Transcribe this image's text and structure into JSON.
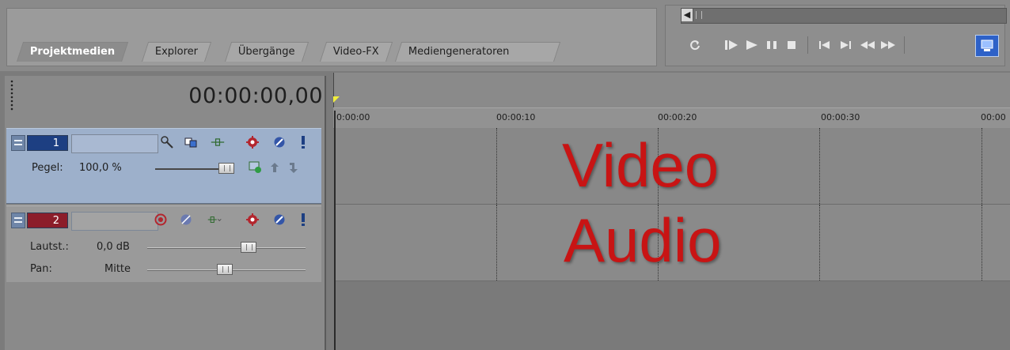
{
  "tabs": [
    "Projektmedien",
    "Explorer",
    "Übergänge",
    "Video-FX",
    "Mediengeneratoren"
  ],
  "timecode": "00:00:00,00",
  "ruler_ticks": [
    "0:00:00",
    "00:00:10",
    "00:00:20",
    "00:00:30",
    "00:00"
  ],
  "video_track": {
    "number": "1",
    "level_label": "Pegel:",
    "level_value": "100,0 %",
    "level_fraction": 0.9,
    "color": "#1d3f82"
  },
  "audio_track": {
    "number": "2",
    "volume_label": "Lautst.:",
    "volume_value": "0,0 dB",
    "pan_label": "Pan:",
    "pan_value": "Mitte",
    "color": "#8c1d2a"
  },
  "overlay": {
    "video_text": "Video",
    "audio_text": "Audio",
    "color": "#c81414"
  },
  "transport_icons": [
    "loop-icon",
    "play-from-start-icon",
    "play-icon",
    "pause-icon",
    "stop-icon",
    "go-to-start-icon",
    "go-to-end-icon",
    "rewind-icon",
    "fast-forward-icon",
    "preview-window-icon"
  ]
}
